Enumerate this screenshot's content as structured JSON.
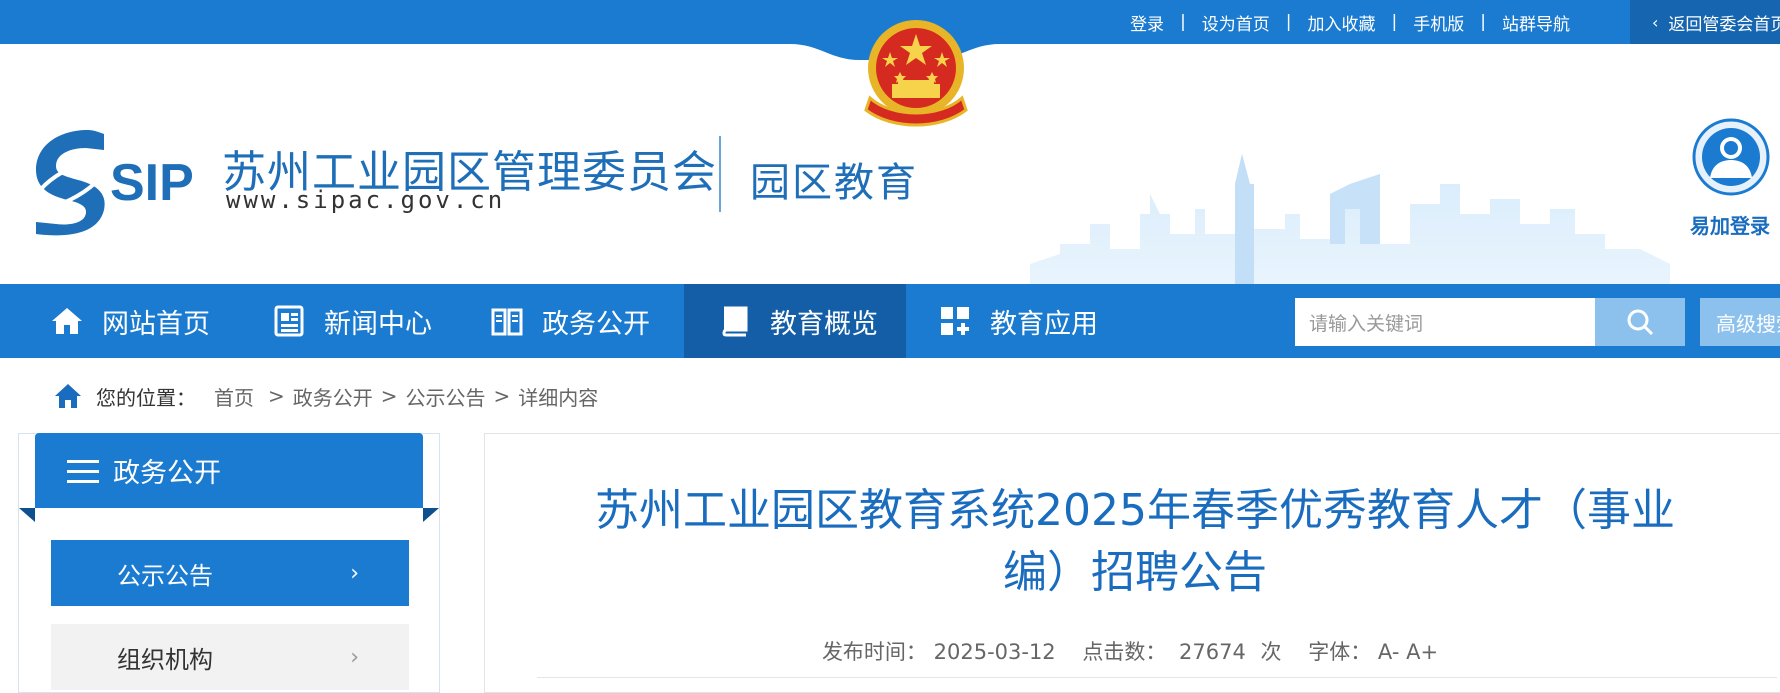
{
  "topbar": {
    "links": [
      "登录",
      "设为首页",
      "加入收藏",
      "手机版",
      "站群导航"
    ],
    "back_label": "返回管委会首页"
  },
  "header": {
    "logo_text": "SIP",
    "org_name": "苏州工业园区管理委员会",
    "org_url": "www.sipac.gov.cn",
    "section_name": "园区教育",
    "login_widget_label": "易加登录"
  },
  "nav": {
    "items": [
      {
        "label": "网站首页",
        "icon": "home-icon"
      },
      {
        "label": "新闻中心",
        "icon": "news-icon"
      },
      {
        "label": "政务公开",
        "icon": "book-open-icon"
      },
      {
        "label": "教育概览",
        "icon": "book-icon"
      },
      {
        "label": "教育应用",
        "icon": "apps-icon"
      }
    ],
    "active_index": 3,
    "search_placeholder": "请输入关键词",
    "advanced_search_label": "高级搜索"
  },
  "breadcrumb": {
    "prefix": "您的位置：",
    "items": [
      "首页",
      "政务公开",
      "公示公告",
      "详细内容"
    ]
  },
  "sidebar": {
    "title": "政务公开",
    "items": [
      {
        "label": "公示公告",
        "active": true
      },
      {
        "label": "组织机构",
        "active": false
      }
    ]
  },
  "article": {
    "title_line1": "苏州工业园区教育系统2025年春季优秀教育人才（事业",
    "title_line2": "编）招聘公告",
    "publish_label": "发布时间：",
    "publish_date": "2025-03-12",
    "clicks_label": "点击数：",
    "clicks": "27674",
    "clicks_unit": "次",
    "font_label": "字体：",
    "font_smaller": "A-",
    "font_larger": "A+"
  },
  "colors": {
    "brand_blue": "#1a7bd0",
    "brand_dark": "#145ea8",
    "title_blue": "#1a6cbf"
  }
}
